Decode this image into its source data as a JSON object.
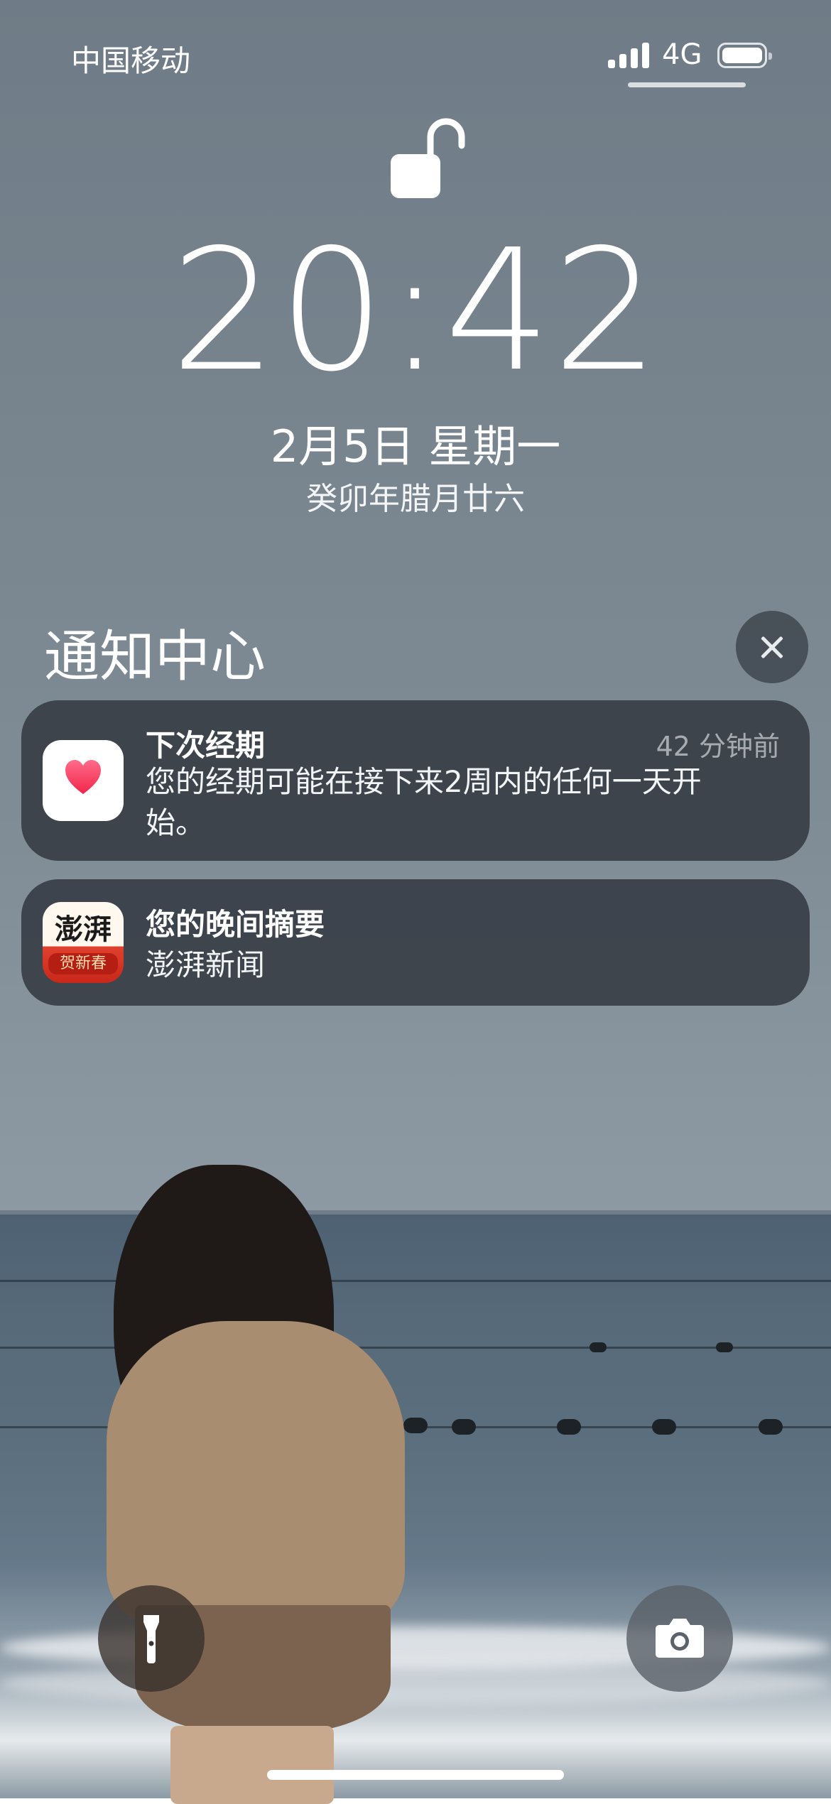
{
  "status_bar": {
    "carrier": "中国移动",
    "network": "4G"
  },
  "lock_screen": {
    "time": "20:42",
    "date": "2月5日 星期一",
    "lunar_date": "癸卯年腊月廿六"
  },
  "notification_center": {
    "title": "通知中心",
    "notifications": [
      {
        "app_icon": "health-heart-icon",
        "title": "下次经期",
        "time": "42 分钟前",
        "body": "您的经期可能在接下来2周内的任何一天开始。"
      },
      {
        "app_icon": "thepaper-news-icon",
        "app_icon_text": "澎湃",
        "app_icon_sub": "贺新春",
        "title": "您的晚间摘要",
        "body": "澎湃新闻"
      }
    ]
  },
  "quick_actions": {
    "left": "flashlight-icon",
    "right": "camera-icon"
  }
}
